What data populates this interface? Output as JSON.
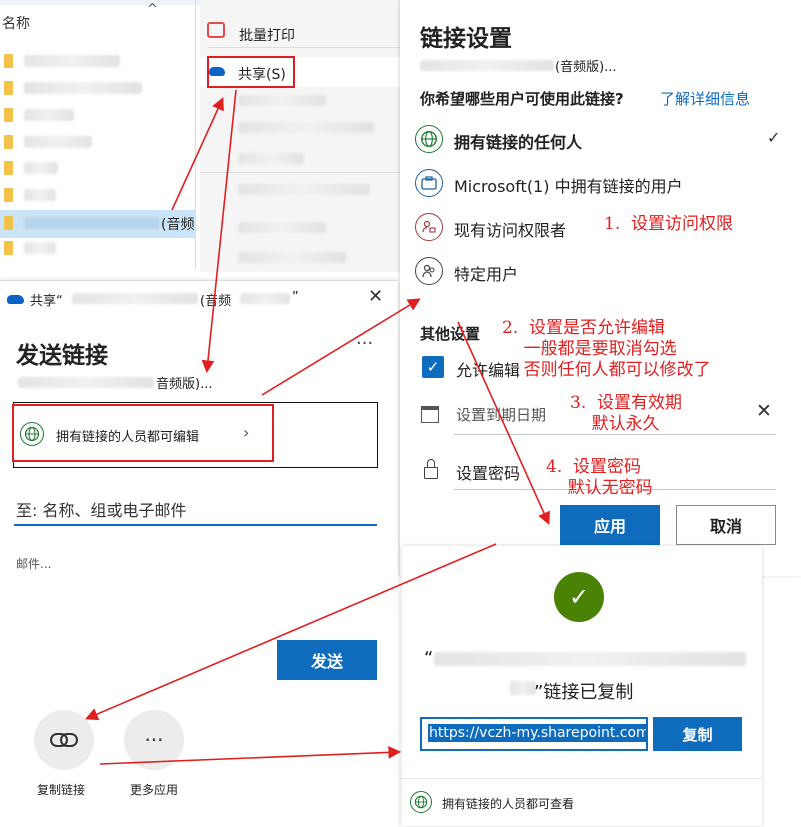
{
  "explorer": {
    "header_label": "名称",
    "chevron": "^",
    "selected_suffix": "(音频"
  },
  "context_menu": {
    "print_label": "批量打印",
    "share_label": "共享(S)"
  },
  "send_link": {
    "title_prefix": "共享“",
    "title_mid": "(音频",
    "title_end": "”",
    "heading": "发送链接",
    "filename_suffix": "音频版)...",
    "more_dots": "···",
    "permission_label": "拥有链接的人员都可编辑",
    "to_placeholder": "至: 名称、组或电子邮件",
    "message_placeholder": "邮件...",
    "send_button": "发送",
    "copy_link_label": "复制链接",
    "more_apps_label": "更多应用",
    "more_apps_icon": "···"
  },
  "link_settings": {
    "title": "链接设置",
    "filename_suffix": "(音频版)...",
    "question": "你希望哪些用户可使用此链接?",
    "learn_more": "了解详细信息",
    "options": [
      {
        "label": "拥有链接的任何人",
        "icon": "globe-icon",
        "selected": true
      },
      {
        "label": "Microsoft(1) 中拥有链接的用户",
        "icon": "briefcase-icon",
        "selected": false
      },
      {
        "label": "现有访问权限者",
        "icon": "people-lock-icon",
        "selected": false
      },
      {
        "label": "特定用户",
        "icon": "people-icon",
        "selected": false
      }
    ],
    "check_mark": "✓",
    "other_settings": "其他设置",
    "allow_edit_label": "允许编辑",
    "allow_edit_checked": true,
    "expiry_placeholder": "设置到期日期",
    "password_label": "设置密码",
    "apply_button": "应用",
    "cancel_button": "取消"
  },
  "copied_panel": {
    "filename_open": "“",
    "copied_text": "”链接已复制",
    "url": "https://vczh-my.sharepoint.com",
    "copy_button": "复制",
    "footer_label": "拥有链接的人员都可查看"
  },
  "annotations": {
    "note1": "1.  设置访问权限",
    "note2": "2.  设置是否允许编辑\n    一般都是要取消勾选\n    否则任何人都可以修改了",
    "note3": "3.  设置有效期\n    默认永久",
    "note4": "4.  设置密码\n    默认无密码"
  },
  "colors": {
    "accent_blue": "#0f6cbd",
    "annotation_red": "#e02020",
    "success_green": "#498205"
  }
}
